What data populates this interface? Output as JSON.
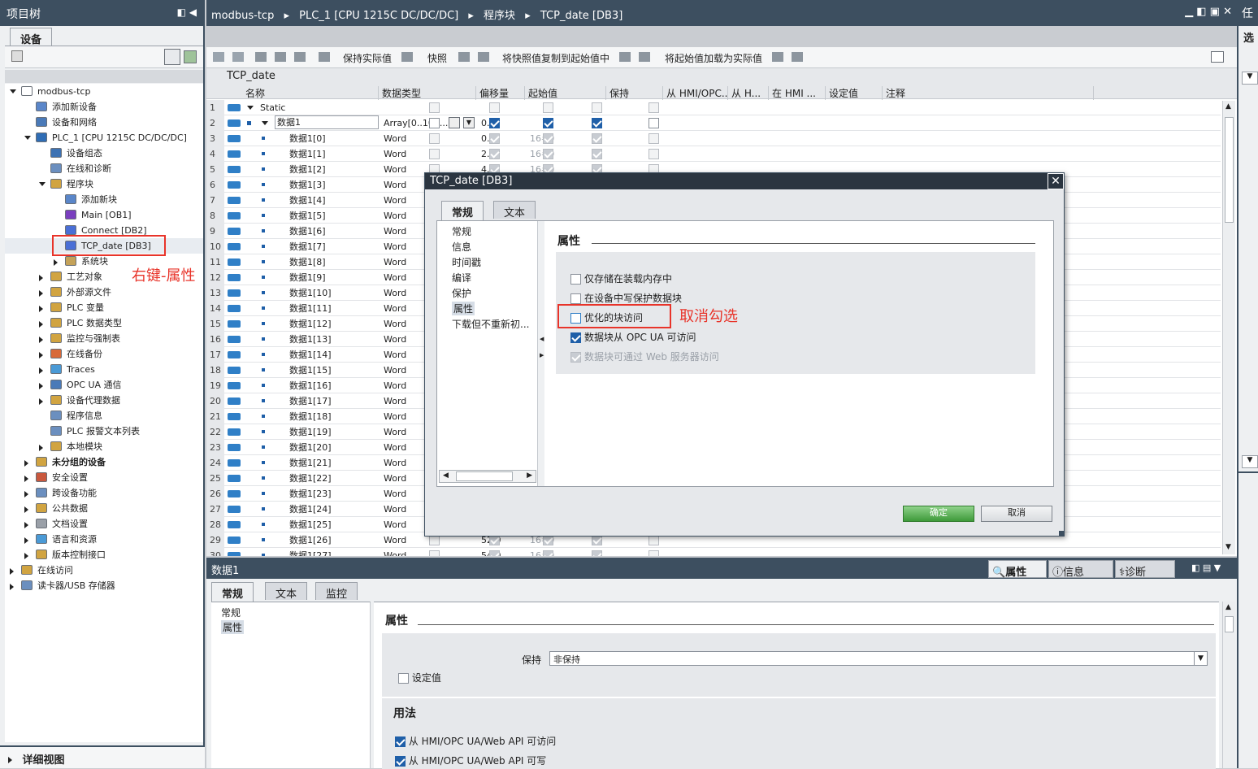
{
  "left_panel": {
    "title": "项目树",
    "tab": "设备",
    "details_view": "详细视图",
    "tree": [
      {
        "label": "modbus-tcp",
        "indent": 0,
        "expand": "open",
        "color": "#ffffff",
        "bold": false
      },
      {
        "label": "添加新设备",
        "indent": 1,
        "expand": "",
        "color": "#5a86c9",
        "bold": false
      },
      {
        "label": "设备和网络",
        "indent": 1,
        "expand": "",
        "color": "#4a7ab8",
        "bold": false
      },
      {
        "label": "PLC_1 [CPU 1215C DC/DC/DC]",
        "indent": 1,
        "expand": "open",
        "color": "#2f6db5",
        "bold": false
      },
      {
        "label": "设备组态",
        "indent": 2,
        "expand": "",
        "color": "#3d72b3",
        "bold": false
      },
      {
        "label": "在线和诊断",
        "indent": 2,
        "expand": "",
        "color": "#6b8fbf",
        "bold": false
      },
      {
        "label": "程序块",
        "indent": 2,
        "expand": "open",
        "color": "#d1a441",
        "bold": false
      },
      {
        "label": "添加新块",
        "indent": 3,
        "expand": "",
        "color": "#5a86c9",
        "bold": false
      },
      {
        "label": "Main [OB1]",
        "indent": 3,
        "expand": "",
        "color": "#7a3fbf",
        "bold": false
      },
      {
        "label": "Connect [DB2]",
        "indent": 3,
        "expand": "",
        "color": "#4a6fd6",
        "bold": false
      },
      {
        "label": "TCP_date [DB3]",
        "indent": 3,
        "expand": "",
        "color": "#4a6fd6",
        "bold": false
      },
      {
        "label": "系统块",
        "indent": 3,
        "expand": "closed",
        "color": "#c4a259",
        "bold": false
      },
      {
        "label": "工艺对象",
        "indent": 2,
        "expand": "closed",
        "color": "#d1a441",
        "bold": false
      },
      {
        "label": "外部源文件",
        "indent": 2,
        "expand": "closed",
        "color": "#d1a441",
        "bold": false
      },
      {
        "label": "PLC 变量",
        "indent": 2,
        "expand": "closed",
        "color": "#d1a441",
        "bold": false
      },
      {
        "label": "PLC 数据类型",
        "indent": 2,
        "expand": "closed",
        "color": "#d1a441",
        "bold": false
      },
      {
        "label": "监控与强制表",
        "indent": 2,
        "expand": "closed",
        "color": "#d1a441",
        "bold": false
      },
      {
        "label": "在线备份",
        "indent": 2,
        "expand": "closed",
        "color": "#d86a3a",
        "bold": false
      },
      {
        "label": "Traces",
        "indent": 2,
        "expand": "closed",
        "color": "#4a9ad6",
        "bold": false
      },
      {
        "label": "OPC UA 通信",
        "indent": 2,
        "expand": "closed",
        "color": "#4a7ab8",
        "bold": false
      },
      {
        "label": "设备代理数据",
        "indent": 2,
        "expand": "closed",
        "color": "#d1a441",
        "bold": false
      },
      {
        "label": "程序信息",
        "indent": 2,
        "expand": "",
        "color": "#6b8fbf",
        "bold": false
      },
      {
        "label": "PLC 报警文本列表",
        "indent": 2,
        "expand": "",
        "color": "#6b8fbf",
        "bold": false
      },
      {
        "label": "本地模块",
        "indent": 2,
        "expand": "closed",
        "color": "#d1a441",
        "bold": false
      },
      {
        "label": "未分组的设备",
        "indent": 1,
        "expand": "closed",
        "color": "#d1a441",
        "bold": true
      },
      {
        "label": "安全设置",
        "indent": 1,
        "expand": "closed",
        "color": "#c9583e",
        "bold": false
      },
      {
        "label": "跨设备功能",
        "indent": 1,
        "expand": "closed",
        "color": "#6b8fbf",
        "bold": false
      },
      {
        "label": "公共数据",
        "indent": 1,
        "expand": "closed",
        "color": "#d1a441",
        "bold": false
      },
      {
        "label": "文档设置",
        "indent": 1,
        "expand": "closed",
        "color": "#9aa0a8",
        "bold": false
      },
      {
        "label": "语言和资源",
        "indent": 1,
        "expand": "closed",
        "color": "#4a9ad6",
        "bold": false
      },
      {
        "label": "版本控制接口",
        "indent": 1,
        "expand": "closed",
        "color": "#d1a441",
        "bold": false
      },
      {
        "label": "在线访问",
        "indent": 0,
        "expand": "closed",
        "color": "#d1a441",
        "bold": false
      },
      {
        "label": "读卡器/USB 存储器",
        "indent": 0,
        "expand": "closed",
        "color": "#6b8fbf",
        "bold": false
      }
    ]
  },
  "annotations": {
    "right_click": "右键-属性",
    "uncheck": "取消勾选",
    "color": "#e8342a"
  },
  "header": {
    "breadcrumb": [
      "modbus-tcp",
      "PLC_1 [CPU 1215C DC/DC/DC]",
      "程序块",
      "TCP_date [DB3]"
    ],
    "right_panel_title": "任",
    "right_panel_sub": "选"
  },
  "toolbar": {
    "keep_actual": "保持实际值",
    "snapshot": "快照",
    "copy_snapshot": "将快照值复制到起始值中",
    "load_start": "将起始值加载为实际值"
  },
  "db": {
    "name": "TCP_date",
    "columns": [
      "名称",
      "数据类型",
      "偏移量",
      "起始值",
      "保持",
      "从 HMI/OPC...",
      "从 H...",
      "在 HMI ...",
      "设定值",
      "注释"
    ],
    "static_label": "Static",
    "array_row": {
      "name": "数据1",
      "type": "Array[0..100...",
      "offset": "0.0"
    },
    "rows": [
      {
        "name": "数据1[0]",
        "type": "Word",
        "offset": "0.0",
        "start": "16#0"
      },
      {
        "name": "数据1[1]",
        "type": "Word",
        "offset": "2.0",
        "start": "16#0"
      },
      {
        "name": "数据1[2]",
        "type": "Word",
        "offset": "4.0",
        "start": "16#0"
      },
      {
        "name": "数据1[3]",
        "type": "Word",
        "offset": "",
        "start": ""
      },
      {
        "name": "数据1[4]",
        "type": "Word",
        "offset": "",
        "start": ""
      },
      {
        "name": "数据1[5]",
        "type": "Word",
        "offset": "",
        "start": ""
      },
      {
        "name": "数据1[6]",
        "type": "Word",
        "offset": "",
        "start": ""
      },
      {
        "name": "数据1[7]",
        "type": "Word",
        "offset": "",
        "start": ""
      },
      {
        "name": "数据1[8]",
        "type": "Word",
        "offset": "",
        "start": ""
      },
      {
        "name": "数据1[9]",
        "type": "Word",
        "offset": "",
        "start": ""
      },
      {
        "name": "数据1[10]",
        "type": "Word",
        "offset": "",
        "start": ""
      },
      {
        "name": "数据1[11]",
        "type": "Word",
        "offset": "",
        "start": ""
      },
      {
        "name": "数据1[12]",
        "type": "Word",
        "offset": "",
        "start": ""
      },
      {
        "name": "数据1[13]",
        "type": "Word",
        "offset": "",
        "start": ""
      },
      {
        "name": "数据1[14]",
        "type": "Word",
        "offset": "",
        "start": ""
      },
      {
        "name": "数据1[15]",
        "type": "Word",
        "offset": "",
        "start": ""
      },
      {
        "name": "数据1[16]",
        "type": "Word",
        "offset": "",
        "start": ""
      },
      {
        "name": "数据1[17]",
        "type": "Word",
        "offset": "",
        "start": ""
      },
      {
        "name": "数据1[18]",
        "type": "Word",
        "offset": "",
        "start": ""
      },
      {
        "name": "数据1[19]",
        "type": "Word",
        "offset": "",
        "start": ""
      },
      {
        "name": "数据1[20]",
        "type": "Word",
        "offset": "",
        "start": ""
      },
      {
        "name": "数据1[21]",
        "type": "Word",
        "offset": "",
        "start": ""
      },
      {
        "name": "数据1[22]",
        "type": "Word",
        "offset": "",
        "start": ""
      },
      {
        "name": "数据1[23]",
        "type": "Word",
        "offset": "",
        "start": ""
      },
      {
        "name": "数据1[24]",
        "type": "Word",
        "offset": "",
        "start": ""
      },
      {
        "name": "数据1[25]",
        "type": "Word",
        "offset": "",
        "start": ""
      },
      {
        "name": "数据1[26]",
        "type": "Word",
        "offset": "52.0",
        "start": "16#0"
      },
      {
        "name": "数据1[27]",
        "type": "Word",
        "offset": "54.0",
        "start": "16#0"
      }
    ]
  },
  "dialog": {
    "title": "TCP_date [DB3]",
    "tabs": [
      "常规",
      "文本"
    ],
    "nav": [
      "常规",
      "信息",
      "时间戳",
      "编译",
      "保护",
      "属性",
      "下载但不重新初..."
    ],
    "section": "属性",
    "options": [
      {
        "label": "仅存储在装载内存中",
        "checked": false,
        "disabled": false
      },
      {
        "label": "在设备中写保护数据块",
        "checked": false,
        "disabled": false
      },
      {
        "label": "优化的块访问",
        "checked": false,
        "disabled": false
      },
      {
        "label": "数据块从 OPC UA 可访问",
        "checked": true,
        "disabled": false
      },
      {
        "label": "数据块可通过 Web 服务器访问",
        "checked": true,
        "disabled": true
      }
    ],
    "ok": "确定",
    "cancel": "取消"
  },
  "bottom": {
    "title": "数据1",
    "right_tabs": [
      "属性",
      "信息",
      "诊断"
    ],
    "tabs": [
      "常规",
      "文本",
      "监控"
    ],
    "nav": [
      "常规",
      "属性"
    ],
    "section": "属性",
    "retain_label": "保持",
    "retain_value": "非保持",
    "setpoint": "设定值",
    "usage": "用法",
    "usage_opts": [
      "从 HMI/OPC UA/Web API 可访问",
      "从 HMI/OPC UA/Web API 可写"
    ]
  }
}
